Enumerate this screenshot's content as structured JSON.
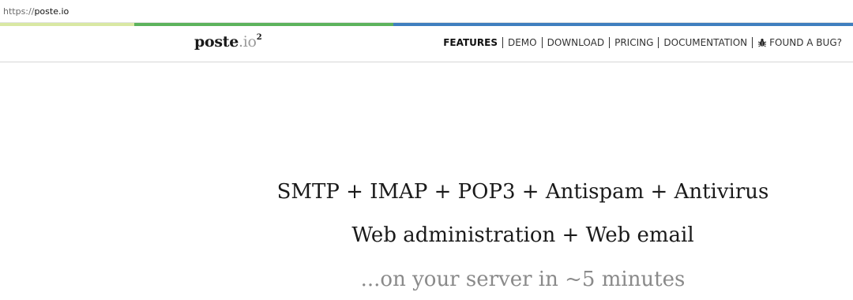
{
  "browser": {
    "url_scheme": "https://",
    "url_host": "poste.io"
  },
  "brand": {
    "name": "poste",
    "tld": ".io",
    "superscript": "2"
  },
  "nav": {
    "items": [
      {
        "label": "FEATURES",
        "active": true
      },
      {
        "label": "DEMO",
        "active": false
      },
      {
        "label": "DOWNLOAD",
        "active": false
      },
      {
        "label": "PRICING",
        "active": false
      },
      {
        "label": "DOCUMENTATION",
        "active": false
      },
      {
        "label": "FOUND A BUG?",
        "active": false,
        "icon": "bug-icon"
      }
    ]
  },
  "hero": {
    "line1": "SMTP + IMAP + POP3 + Antispam + Antivirus",
    "line2": "Web administration + Web email",
    "line3": "...on your server in ~5 minutes"
  },
  "colors": {
    "stripe_light_green": "#d9e8a3",
    "stripe_green": "#5cb35c",
    "stripe_blue": "#3f7fbf",
    "muted_text": "#8a8a8a"
  }
}
